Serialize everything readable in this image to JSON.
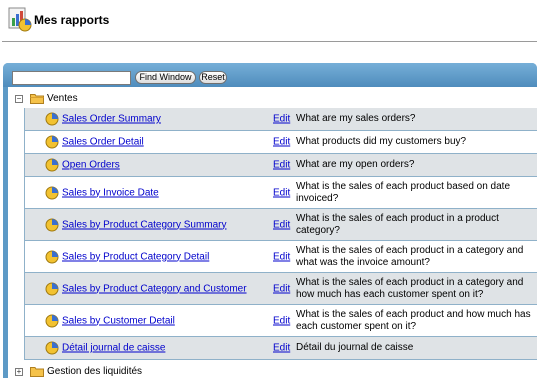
{
  "header": {
    "title": "Mes rapports",
    "icon": "reports-chart-icon"
  },
  "search": {
    "value": "",
    "placeholder": "",
    "find_label": "Find Window",
    "reset_label": "Reset"
  },
  "tree": {
    "group1": {
      "toggle": "⊟",
      "label": "Ventes",
      "expanded": true
    },
    "group2": {
      "toggle": "⊞",
      "label": "Gestion des liquidités",
      "expanded": false
    }
  },
  "reports": [
    {
      "label": "Sales Order Summary",
      "edit": "Edit",
      "desc": "What are my sales orders?"
    },
    {
      "label": "Sales Order Detail",
      "edit": "Edit",
      "desc": "What products did my customers buy?"
    },
    {
      "label": "Open Orders",
      "edit": "Edit",
      "desc": "What are my open orders?"
    },
    {
      "label": "Sales by Invoice Date",
      "edit": "Edit",
      "desc": "What is the sales of each product based on date invoiced?"
    },
    {
      "label": "Sales by Product Category Summary",
      "edit": "Edit",
      "desc": "What is the sales of each product in a product category?"
    },
    {
      "label": "Sales by Product Category Detail",
      "edit": "Edit",
      "desc": "What is the sales of each product in a category and what was the invoice amount?"
    },
    {
      "label": "Sales by Product Category and Customer",
      "edit": "Edit",
      "desc": "What is the sales of each product in a category and how much has each customer spent on it?"
    },
    {
      "label": "Sales by Customer Detail",
      "edit": "Edit",
      "desc": "What is the sales of each product and how much has each customer spent on it?"
    },
    {
      "label": "Détail journal de caisse",
      "edit": "Edit",
      "desc": "Détail du journal de caisse"
    }
  ],
  "colors": {
    "link": "#0000cc",
    "panel": "#5d9ac6",
    "row_alt": "#dfe3e6"
  }
}
